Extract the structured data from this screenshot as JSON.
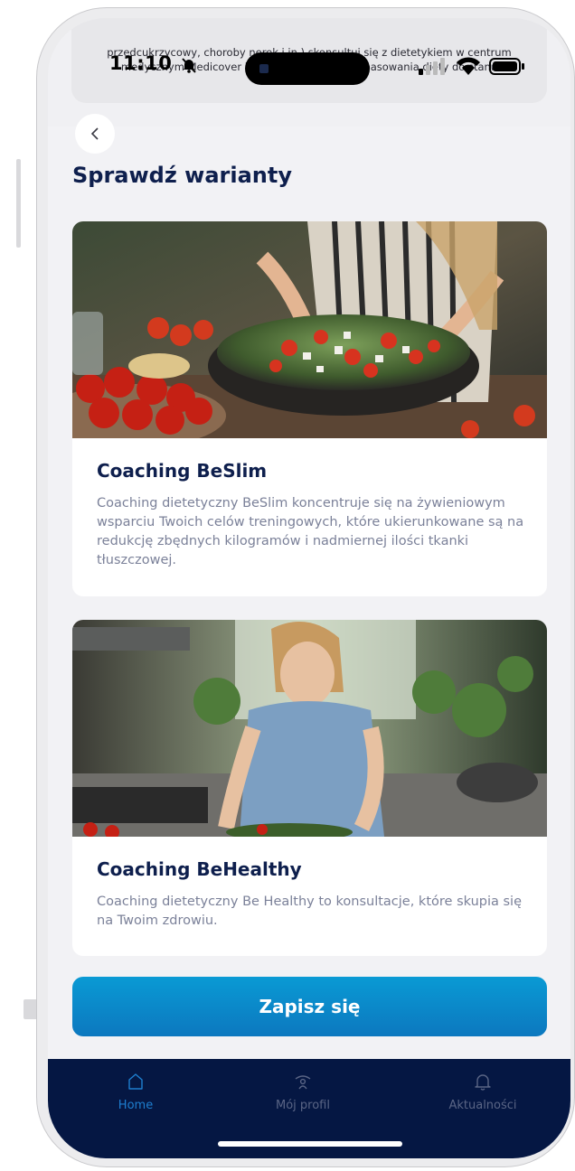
{
  "status_bar": {
    "time": "11:10"
  },
  "banner": {
    "text": "przedcukrzycowy, choroby nerek i in.) skonsultuj się z dietetykiem w centrum medycznym Medicover lub Damiana w celu dopasowania diety do stanu"
  },
  "page": {
    "title": "Sprawdź warianty"
  },
  "cards": [
    {
      "title": "Coaching BeSlim",
      "description": "Coaching dietetyczny BeSlim koncentruje się na żywieniowym wsparciu Twoich celów treningowych, które ukierunkowane są na redukcję zbędnych kilogramów i nadmiernej ilości tkanki tłuszczowej."
    },
    {
      "title": "Coaching BeHealthy",
      "description": "Coaching dietetyczny Be Healthy to konsultacje, które skupia się na Twoim zdrowiu."
    }
  ],
  "cta": {
    "label": "Zapisz się"
  },
  "bottom_nav": {
    "items": [
      {
        "label": "Home",
        "icon": "home-icon",
        "active": true
      },
      {
        "label": "Mój profil",
        "icon": "profile-icon",
        "active": false
      },
      {
        "label": "Aktualności",
        "icon": "bell-icon",
        "active": false
      }
    ]
  },
  "colors": {
    "primary_dark": "#0e1f4d",
    "accent_blue": "#0c8ccb",
    "nav_bg": "#051743",
    "nav_active": "#1e7fd0"
  }
}
